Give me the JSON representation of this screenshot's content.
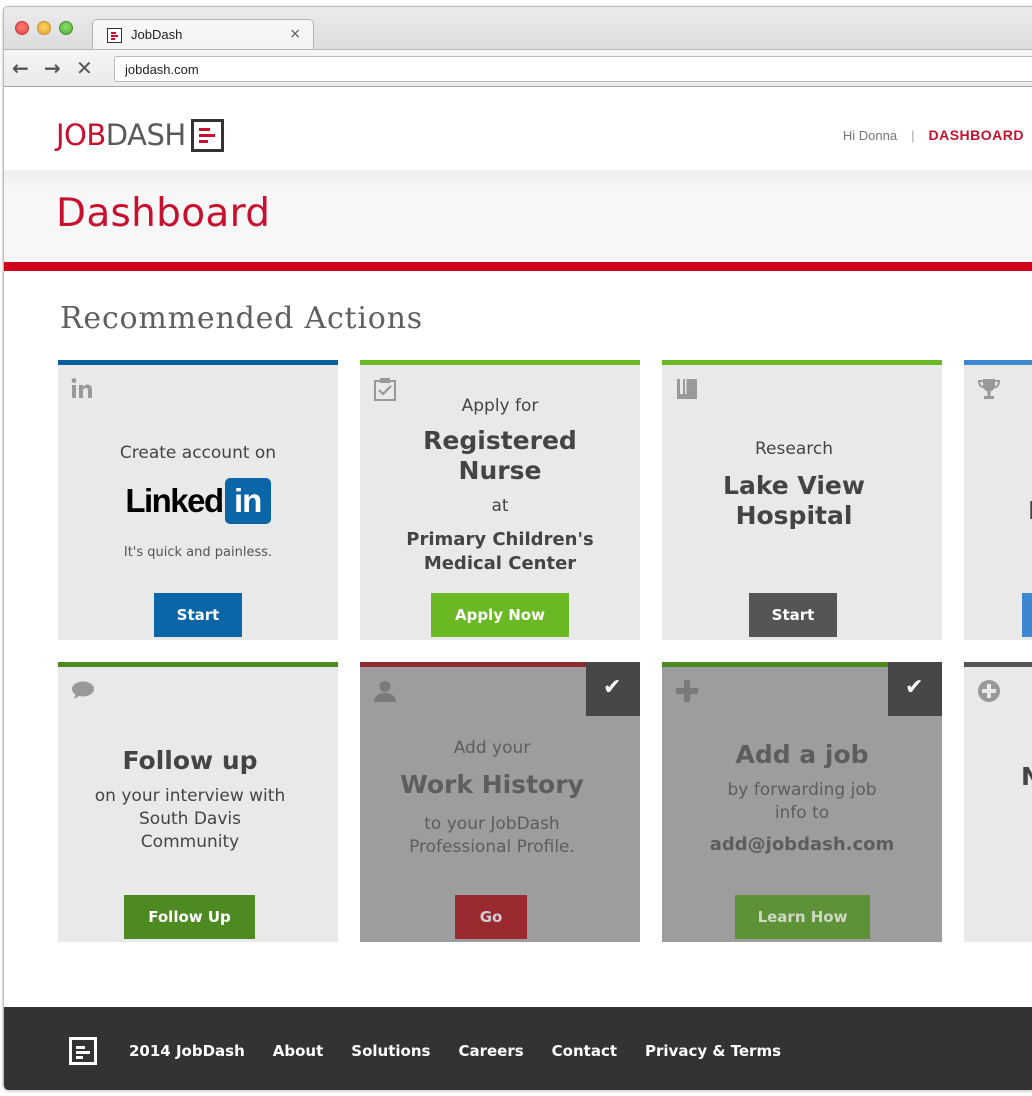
{
  "browser": {
    "tab_title": "JobDash",
    "tab_close": "×",
    "back": "←",
    "forward": "→",
    "stop": "✕",
    "url": "jobdash.com"
  },
  "header": {
    "logo_job": "JOB",
    "logo_dash": "DASH",
    "greeting": "Hi Donna",
    "separator": "|",
    "dashboard_link": "DASHBOARD"
  },
  "page_title": "Dashboard",
  "section_title": "Recommended Actions",
  "colors": {
    "brand_red": "#c8102e",
    "linkedin_blue": "#0b66a8",
    "green": "#6ab823",
    "dark_green": "#4e8a22",
    "gray_button": "#555555",
    "dim_red": "#9b2a30"
  },
  "cards": {
    "linkedin": {
      "icon": "linkedin-icon",
      "line1": "Create account on",
      "brand_text": "Linked",
      "brand_box": "in",
      "tagline": "It's quick and painless.",
      "button": "Start"
    },
    "apply": {
      "icon": "clipboard-check-icon",
      "line1": "Apply for",
      "title_line1": "Registered",
      "title_line2": "Nurse",
      "at": "at",
      "org_line1": "Primary Children's",
      "org_line2": "Medical Center",
      "button": "Apply Now"
    },
    "research": {
      "icon": "book-icon",
      "line1": "Research",
      "title_line1": "Lake View",
      "title_line2": "Hospital",
      "button": "Start"
    },
    "followup": {
      "icon": "speech-bubble-icon",
      "title": "Follow up",
      "line1": "on your interview with",
      "line2": "South Davis",
      "line3": "Community",
      "button": "Follow Up"
    },
    "workhistory": {
      "icon": "person-icon",
      "line1": "Add your",
      "title": "Work History",
      "line2": "to your JobDash",
      "line3": "Professional Profile.",
      "button": "Go",
      "completed": "✔"
    },
    "addjob": {
      "icon": "plus-icon",
      "title": "Add a job",
      "line1": "by forwarding job",
      "line2": "info to",
      "email": "add@jobdash.com",
      "button": "Learn How",
      "completed": "✔"
    },
    "partial_top": {
      "icon": "trophy-icon",
      "fragment": "I"
    },
    "partial_bottom": {
      "icon": "plus-circle-icon",
      "fragment": "N"
    }
  },
  "footer": {
    "copyright": "2014 JobDash",
    "links": [
      "About",
      "Solutions",
      "Careers",
      "Contact",
      "Privacy & Terms"
    ]
  }
}
